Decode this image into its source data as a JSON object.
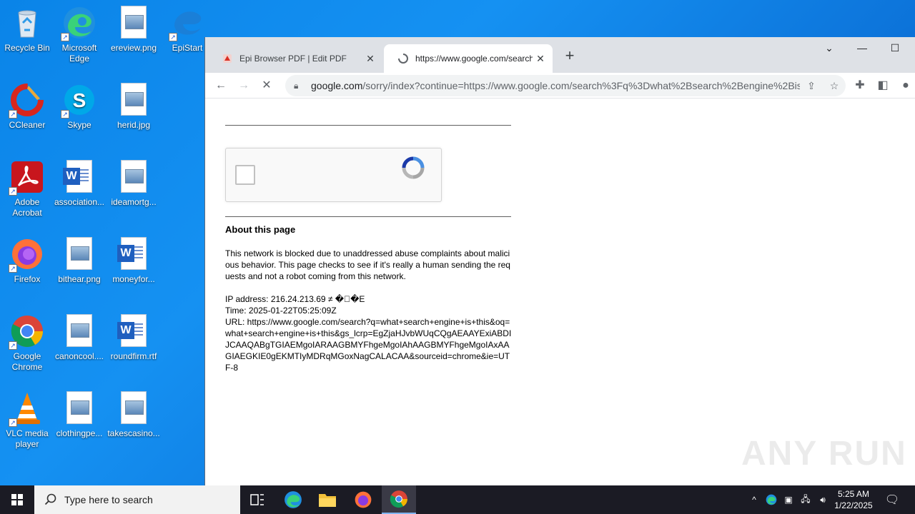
{
  "desktop": {
    "icons": [
      {
        "label": "Recycle Bin"
      },
      {
        "label": "Microsoft Edge"
      },
      {
        "label": "ereview.png"
      },
      {
        "label": "EpiStart"
      },
      {
        "label": "CCleaner"
      },
      {
        "label": "Skype"
      },
      {
        "label": "herid.jpg"
      },
      {
        "label": "Adobe Acrobat"
      },
      {
        "label": "association..."
      },
      {
        "label": "ideamortg..."
      },
      {
        "label": "Firefox"
      },
      {
        "label": "bithear.png"
      },
      {
        "label": "moneyfor..."
      },
      {
        "label": "Google Chrome"
      },
      {
        "label": "canoncool...."
      },
      {
        "label": "roundfirm.rtf"
      },
      {
        "label": "VLC media player"
      },
      {
        "label": "clothingpe..."
      },
      {
        "label": "takescasino..."
      }
    ]
  },
  "browser": {
    "tabs": [
      {
        "title": "Epi Browser PDF | Edit PDF",
        "close": "✕"
      },
      {
        "title": "https://www.google.com/search",
        "close": "✕"
      }
    ],
    "new_tab": "+",
    "address": {
      "host": "google.com",
      "rest": "/sorry/index?continue=https://www.google.com/search%3Fq%3Dwhat%2Bsearch%2Bengine%2Bis..."
    }
  },
  "page": {
    "about_heading": "About this page",
    "paragraph": "This network is blocked due to unaddressed abuse complaints about malicious behavior. This page checks to see if it's really a human sending the requests and not a robot coming from this network.",
    "ip_line": "IP address: 216.24.213.69 ≠ �\u0000�E",
    "time_line": "Time: 2025-01-22T05:25:09Z",
    "url_line": "URL: https://www.google.com/search?q=what+search+engine+is+this&oq=what+search+engine+is+this&gs_lcrp=EgZjaHJvbWUqCQgAEAAYExiABDIJCAAQABgTGIAEMgoIARAAGBMYFhgeMgoIAhAAGBMYFhgeMgoIAxAAGIAEGKIE0gEKMTIyMDRqMGoxNagCALACAA&sourceid=chrome&ie=UTF-8",
    "watermark": "ANY RUN"
  },
  "taskbar": {
    "search_placeholder": "Type here to search",
    "time": "5:25 AM",
    "date": "1/22/2025"
  },
  "colors": {
    "desktop_bg": "#0a84e8",
    "taskbar_bg": "#1b1b24",
    "tabstrip_bg": "#dee1e6"
  }
}
